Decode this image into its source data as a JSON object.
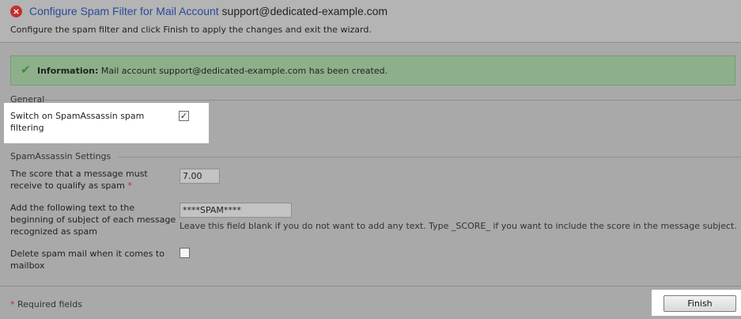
{
  "header": {
    "title_link": "Configure Spam Filter for Mail Account",
    "title_account": "support@dedicated-example.com",
    "subtitle": "Configure the spam filter and click Finish to apply the changes and exit the wizard."
  },
  "info": {
    "label": "Information:",
    "message": "Mail account support@dedicated-example.com has been created."
  },
  "general": {
    "section_title": "General",
    "switch_label_line1": "Switch on SpamAssassin spam",
    "switch_label_line2": "filtering",
    "switch_checked": true
  },
  "spamassassin": {
    "section_title": "SpamAssassin Settings",
    "score_label_line1": "The score that a message must",
    "score_label_line2": "receive to qualify as spam",
    "score_required_mark": "*",
    "score_value": "7.00",
    "subject_label_line1": "Add the following text to the",
    "subject_label_line2": "beginning of subject of each message",
    "subject_label_line3": "recognized as spam",
    "subject_value": "****SPAM****",
    "subject_hint": "Leave this field blank if you do not want to add any text. Type _SCORE_ if you want to include the score in the message subject.",
    "delete_label_line1": "Delete spam mail when it comes to",
    "delete_label_line2": "mailbox",
    "delete_checked": false
  },
  "footer": {
    "required_mark": "*",
    "required_text": "Required fields",
    "finish_label": "Finish"
  },
  "colors": {
    "title_link": "#2a4a9a",
    "info_background": "#8db08a",
    "error_icon": "#c0302d",
    "required_star": "#c0302d"
  },
  "icons": {
    "header_icon": "error-circle-icon",
    "info_icon": "checkmark-icon"
  }
}
